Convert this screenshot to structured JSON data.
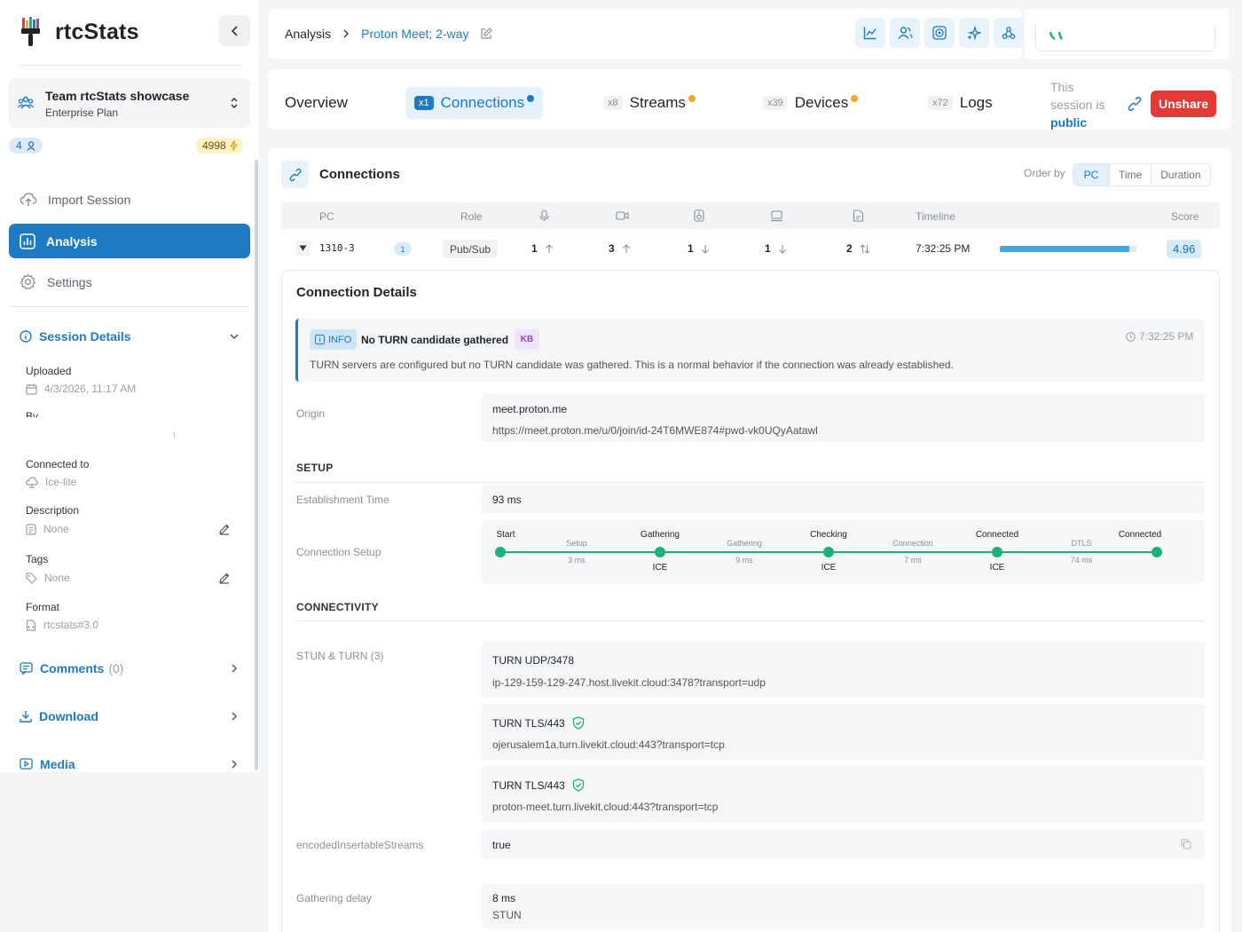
{
  "app": {
    "name": "rtcStats"
  },
  "team": {
    "name": "Team rtcStats showcase",
    "plan": "Enterprise Plan",
    "users": "4",
    "credits": "4998"
  },
  "nav": {
    "import": "Import Session",
    "analysis": "Analysis",
    "settings": "Settings"
  },
  "session_details": {
    "title": "Session Details",
    "uploaded_label": "Uploaded",
    "uploaded_value": "4/3/2026, 11:17 AM",
    "by_label": "By",
    "connected_label": "Connected to",
    "connected_value": "Ice-lite",
    "description_label": "Description",
    "description_value": "None",
    "tags_label": "Tags",
    "tags_value": "None",
    "format_label": "Format",
    "format_value": "rtcstats#3.0"
  },
  "sections": {
    "comments": "Comments",
    "comments_count": "(0)",
    "download": "Download",
    "media": "Media"
  },
  "breadcrumb": {
    "root": "Analysis",
    "current": "Proton Meet; 2-way"
  },
  "tabs": [
    {
      "label": "Overview",
      "count": ""
    },
    {
      "label": "Connections",
      "count": "x1"
    },
    {
      "label": "Streams",
      "count": "x8"
    },
    {
      "label": "Devices",
      "count": "x39"
    },
    {
      "label": "Logs",
      "count": "x72"
    }
  ],
  "share": {
    "line1": "This",
    "line2": "session is",
    "state": "public",
    "button": "Unshare"
  },
  "colors": {
    "accent": "#1e7ac1",
    "danger": "#e53935",
    "success": "#1db07a",
    "warning": "#f5a623"
  },
  "connections": {
    "title": "Connections",
    "order_by": "Order by",
    "order_options": [
      "PC",
      "Time",
      "Duration"
    ],
    "columns": {
      "pc": "PC",
      "role": "Role",
      "timeline": "Timeline",
      "score": "Score"
    },
    "row": {
      "pc": "1310-3",
      "index": "1",
      "role": "Pub/Sub",
      "audio": "1",
      "video": "3",
      "speaker": "1",
      "display": "1",
      "data": "2",
      "time": "7:32:25 PM",
      "score": "4.96",
      "timeline_fill": 0.95
    }
  },
  "details": {
    "title": "Connection Details",
    "alert": {
      "level": "INFO",
      "title": "No TURN candidate gathered",
      "tag": "KB",
      "time": "7:32:25 PM",
      "message": "TURN servers are configured but no TURN candidate was gathered. This is a normal behavior if the connection was already established."
    },
    "origin_label": "Origin",
    "origin_host": "meet.proton.me",
    "origin_url": "https://meet.proton.me/u/0/join/id-24T6MWE874#pwd-vk0UQyAatawl",
    "setup_heading": "SETUP",
    "establishment_label": "Establishment Time",
    "establishment_value": "93 ms",
    "connection_setup_label": "Connection Setup",
    "steps": [
      {
        "top": "Start",
        "bottom": ""
      },
      {
        "top": "Gathering",
        "bottom": "ICE"
      },
      {
        "top": "Checking",
        "bottom": "ICE"
      },
      {
        "top": "Connected",
        "bottom": "ICE"
      },
      {
        "top": "Connected",
        "bottom": ""
      }
    ],
    "phases": [
      {
        "name": "Setup",
        "ms": "3 ms"
      },
      {
        "name": "Gathering",
        "ms": "9 ms"
      },
      {
        "name": "Connection",
        "ms": "7 ms"
      },
      {
        "name": "DTLS",
        "ms": "74 ms"
      }
    ],
    "connectivity_heading": "CONNECTIVITY",
    "stun_label": "STUN & TURN (3)",
    "servers": [
      {
        "name": "TURN UDP/3478",
        "url": "ip-129-159-129-247.host.livekit.cloud:3478?transport=udp",
        "verified": false
      },
      {
        "name": "TURN TLS/443",
        "url": "ojerusalem1a.turn.livekit.cloud:443?transport=tcp",
        "verified": true
      },
      {
        "name": "TURN TLS/443",
        "url": "proton-meet.turn.livekit.cloud:443?transport=tcp",
        "verified": true
      }
    ],
    "eis_label": "encodedInsertableStreams",
    "eis_value": "true",
    "gathering_label": "Gathering delay",
    "gathering_value": "8 ms",
    "gathering_sub": "STUN"
  }
}
